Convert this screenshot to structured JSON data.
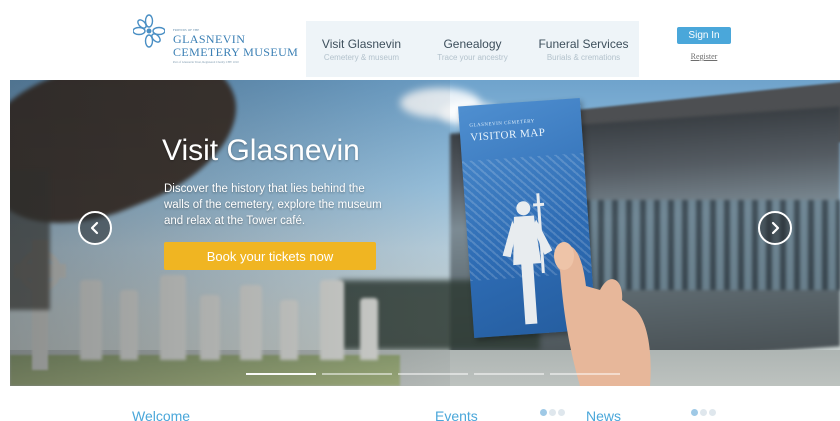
{
  "header": {
    "logo": {
      "pretitle": "FRIENDS OF THE",
      "line1": "GLASNEVIN",
      "line2": "CEMETERY MUSEUM",
      "tagline": "Part of Glasnevin Trust, Registered Charity CHY 1010"
    },
    "nav": [
      {
        "title": "Visit Glasnevin",
        "subtitle": "Cemetery & museum"
      },
      {
        "title": "Genealogy",
        "subtitle": "Trace your ancestry"
      },
      {
        "title": "Funeral Services",
        "subtitle": "Burials & cremations"
      }
    ],
    "signin_label": "Sign In",
    "register_label": "Register"
  },
  "hero": {
    "title": "Visit Glasnevin",
    "description": "Discover the history that lies behind the walls of the cemetery, explore the museum and relax at the Tower café.",
    "cta_label": "Book your tickets now",
    "map_small": "GLASNEVIN CEMETERY",
    "map_large": "VISITOR MAP",
    "slides": 5,
    "active_slide": 1
  },
  "sections": {
    "welcome": "Welcome",
    "events": "Events",
    "news": "News"
  },
  "colors": {
    "accent_blue": "#4aa7da",
    "cta_yellow": "#f0b522",
    "nav_bg": "#eef4f8"
  }
}
